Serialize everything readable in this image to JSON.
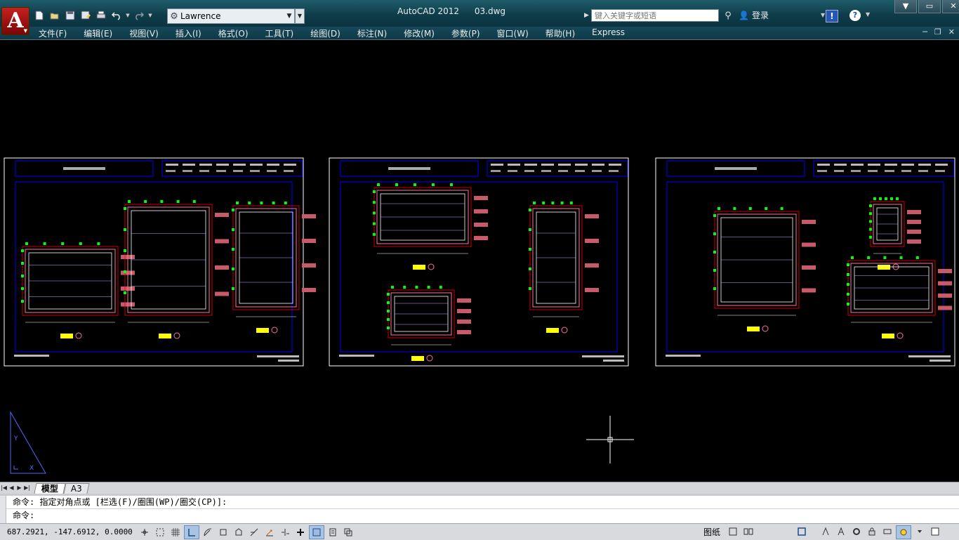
{
  "window": {
    "app_name": "AutoCAD 2012",
    "file_name": "03.dwg"
  },
  "quick_access": {
    "workspace": "Lawrence"
  },
  "search": {
    "placeholder": "键入关键字或短语"
  },
  "account": {
    "login_label": "登录"
  },
  "menu": {
    "items": [
      "文件(F)",
      "编辑(E)",
      "视图(V)",
      "插入(I)",
      "格式(O)",
      "工具(T)",
      "绘图(D)",
      "标注(N)",
      "修改(M)",
      "参数(P)",
      "窗口(W)",
      "帮助(H)",
      "Express"
    ]
  },
  "layout_tabs": {
    "model": "模型",
    "layout": "A3"
  },
  "command": {
    "history": "命令: 指定对角点或 [栏选(F)/圈围(WP)/圈交(CP)]:",
    "prompt": "命令:"
  },
  "status": {
    "coordinates": "687.2921, -147.6912, 0.0000",
    "paper_label": "图纸"
  },
  "colors": {
    "title_bar": "#0f3d4a",
    "drawing_frame": "#0000ff",
    "dimension": "#ff6f9c",
    "annotation": "#c85a6a",
    "marker": "#00ff00",
    "label": "#ffff00",
    "revision_cloud": "#ff0000"
  }
}
